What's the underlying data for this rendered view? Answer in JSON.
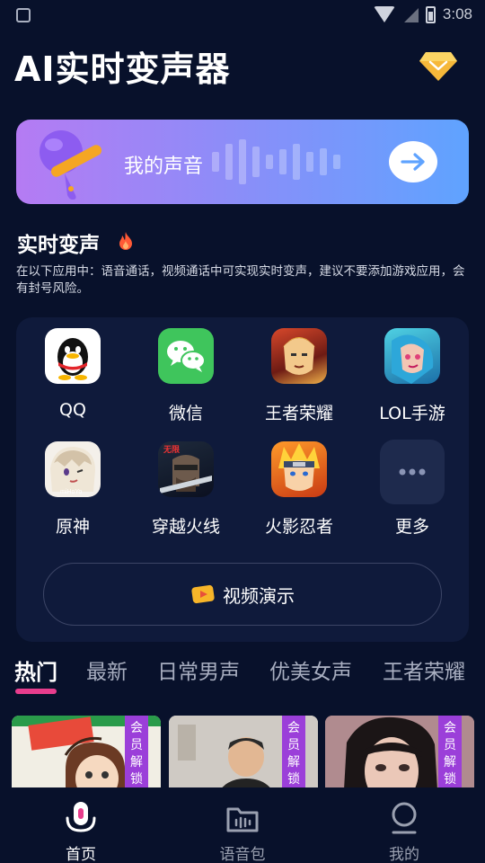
{
  "status_bar": {
    "time": "3:08"
  },
  "header": {
    "title": "AI实时变声器"
  },
  "banner": {
    "label": "我的声音"
  },
  "section": {
    "title": "实时变声",
    "description": "在以下应用中：语音通话，视频通话中可实现实时变声，建议不要添加游戏应用，会有封号风险。"
  },
  "apps": [
    {
      "label": "QQ"
    },
    {
      "label": "微信"
    },
    {
      "label": "王者荣耀"
    },
    {
      "label": "LOL手游"
    },
    {
      "label": "原神"
    },
    {
      "label": "穿越火线"
    },
    {
      "label": "火影忍者"
    },
    {
      "label": "更多"
    }
  ],
  "video_demo": {
    "label": "视频演示"
  },
  "tabs": [
    {
      "label": "热门"
    },
    {
      "label": "最新"
    },
    {
      "label": "日常男声"
    },
    {
      "label": "优美女声"
    },
    {
      "label": "王者荣耀"
    }
  ],
  "cards": [
    {
      "tag": [
        "会",
        "员",
        "解",
        "锁"
      ]
    },
    {
      "tag": [
        "会",
        "员",
        "解",
        "锁"
      ]
    },
    {
      "tag": [
        "会",
        "员",
        "解",
        "锁"
      ]
    }
  ],
  "bottom_nav": [
    {
      "label": "首页"
    },
    {
      "label": "语音包"
    },
    {
      "label": "我的"
    }
  ],
  "colors": {
    "background": "#08112b",
    "card": "#0f1a3b",
    "accent_pink": "#e83d8d",
    "vip_purple": "#9b3fd9",
    "banner_start": "#b57bf3",
    "banner_end": "#5fa3ff"
  }
}
